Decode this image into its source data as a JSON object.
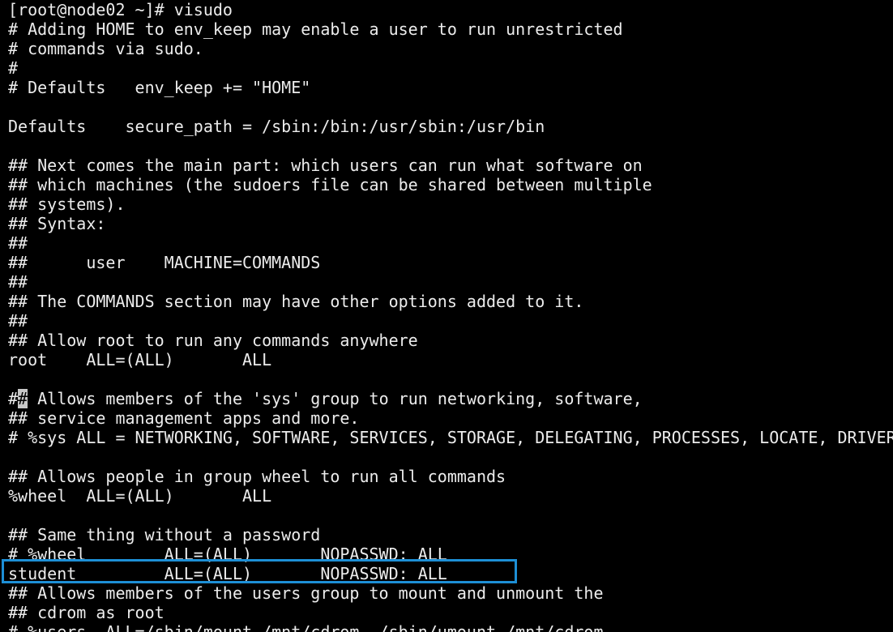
{
  "terminal": {
    "lines": [
      "[root@node02 ~]# visudo",
      "# Adding HOME to env_keep may enable a user to run unrestricted",
      "# commands via sudo.",
      "#",
      "# Defaults   env_keep += \"HOME\"",
      "",
      "Defaults    secure_path = /sbin:/bin:/usr/sbin:/usr/bin",
      "",
      "## Next comes the main part: which users can run what software on",
      "## which machines (the sudoers file can be shared between multiple",
      "## systems).",
      "## Syntax:",
      "##",
      "##      user    MACHINE=COMMANDS",
      "##",
      "## The COMMANDS section may have other options added to it.",
      "##",
      "## Allow root to run any commands anywhere",
      "root    ALL=(ALL)       ALL",
      "",
      "#",
      "## service management apps and more.",
      "# %sys ALL = NETWORKING, SOFTWARE, SERVICES, STORAGE, DELEGATING, PROCESSES, LOCATE, DRIVERS",
      "",
      "## Allows people in group wheel to run all commands",
      "%wheel  ALL=(ALL)       ALL",
      "",
      "## Same thing without a password",
      "# %wheel        ALL=(ALL)       NOPASSWD: ALL",
      "student         ALL=(ALL)       NOPASSWD: ALL",
      "## Allows members of the users group to mount and unmount the",
      "## cdrom as root",
      "# %users  ALL=/sbin/mount /mnt/cdrom, /sbin/umount /mnt/cdrom"
    ],
    "cursor_line": {
      "before": "#",
      "cursor": "#",
      "after": " Allows members of the 'sys' group to run networking, software,"
    }
  },
  "annotation": {
    "highlight_color": "#1d8fd6"
  }
}
